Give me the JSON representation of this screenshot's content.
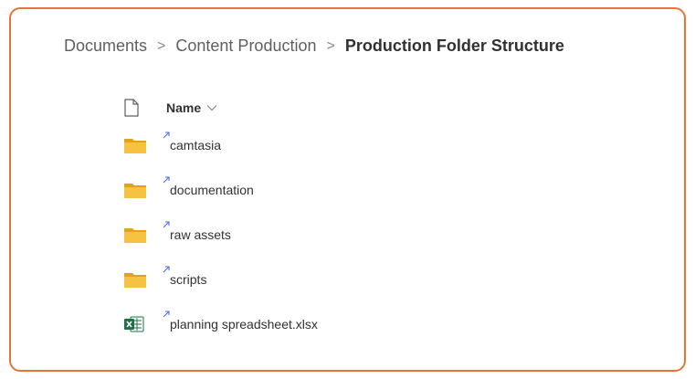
{
  "breadcrumb": {
    "items": [
      "Documents",
      "Content Production"
    ],
    "separator": ">",
    "current": "Production Folder Structure"
  },
  "list": {
    "column_header": "Name",
    "items": [
      {
        "name": "camtasia",
        "type": "folder",
        "icon": "folder-icon"
      },
      {
        "name": "documentation",
        "type": "folder",
        "icon": "folder-icon"
      },
      {
        "name": "raw assets",
        "type": "folder",
        "icon": "folder-icon"
      },
      {
        "name": "scripts",
        "type": "folder",
        "icon": "folder-icon"
      },
      {
        "name": "planning spreadsheet.xlsx",
        "type": "excel",
        "icon": "excel-file-icon"
      }
    ]
  },
  "colors": {
    "frame_border": "#e8733a",
    "folder": "#f5c242",
    "excel": "#1e7145",
    "new_marker": "#4f6bed"
  }
}
